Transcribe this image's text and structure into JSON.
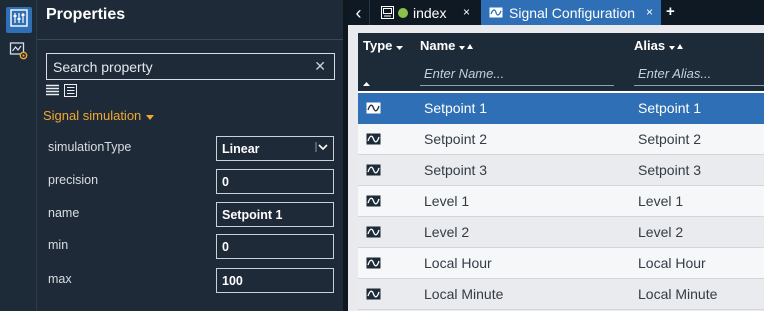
{
  "properties": {
    "title": "Properties",
    "search_placeholder": "Search property",
    "clear_glyph": "✕",
    "section_label": "Signal simulation",
    "rows": [
      {
        "label": "simulationType",
        "value": "Linear"
      },
      {
        "label": "precision",
        "value": "0"
      },
      {
        "label": "name",
        "value": "Setpoint 1"
      },
      {
        "label": "min",
        "value": "0"
      },
      {
        "label": "max",
        "value": "100"
      }
    ]
  },
  "tabs": {
    "back_glyph": "‹",
    "items": [
      {
        "label": "index",
        "close": "×"
      },
      {
        "label": "Signal Configuration",
        "close": "×"
      }
    ],
    "add_glyph": "+"
  },
  "table": {
    "columns": [
      {
        "label": "Type"
      },
      {
        "label": "Name"
      },
      {
        "label": "Alias"
      }
    ],
    "filters": {
      "name_placeholder": "Enter Name...",
      "alias_placeholder": "Enter Alias..."
    },
    "rows": [
      {
        "name": "Setpoint 1",
        "alias": "Setpoint 1",
        "selected": true
      },
      {
        "name": "Setpoint 2",
        "alias": "Setpoint 2"
      },
      {
        "name": "Setpoint 3",
        "alias": "Setpoint 3"
      },
      {
        "name": "Level 1",
        "alias": "Level 1"
      },
      {
        "name": "Level 2",
        "alias": "Level 2"
      },
      {
        "name": "Local Hour",
        "alias": "Local Hour"
      },
      {
        "name": "Local Minute",
        "alias": "Local Minute"
      }
    ]
  },
  "colors": {
    "accent": "#2e6fb5",
    "section": "#f0a830",
    "status_green": "#8bc34a"
  }
}
